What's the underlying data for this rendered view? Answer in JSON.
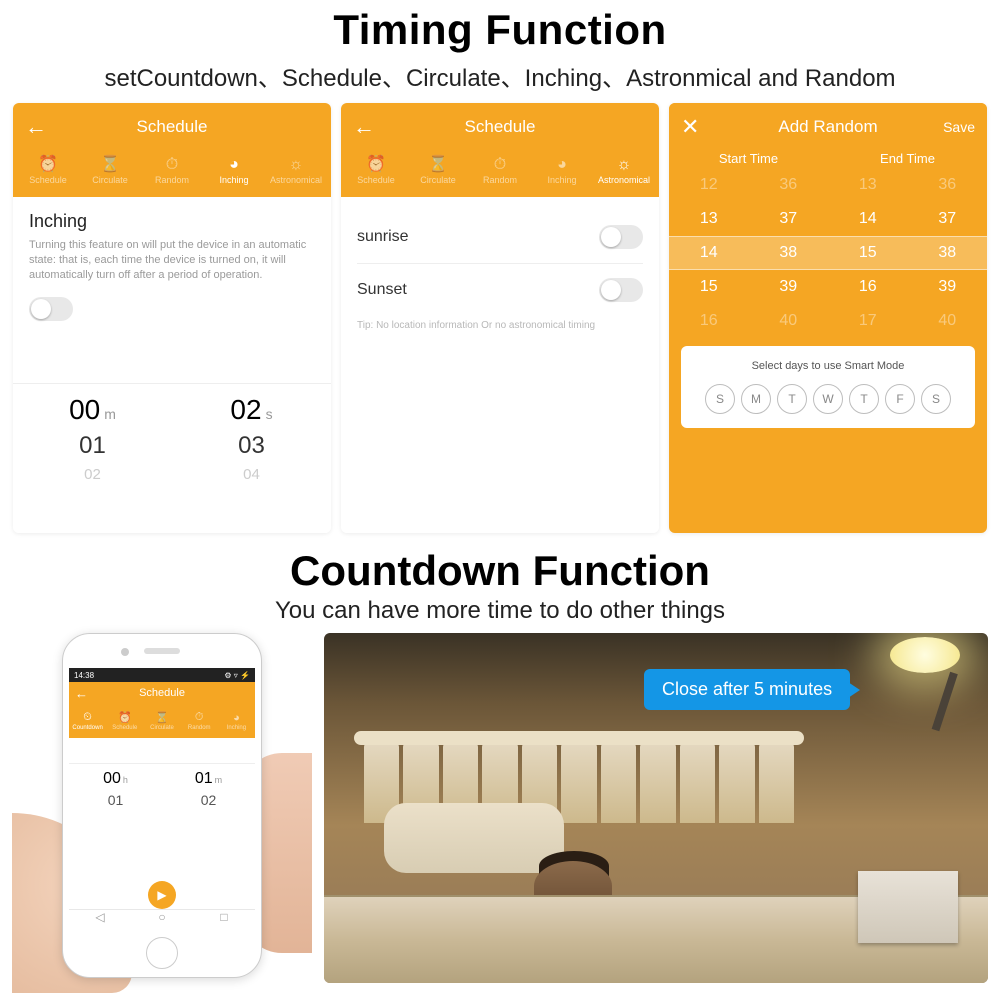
{
  "colors": {
    "primary": "#f5a623",
    "bubble": "#1496e6"
  },
  "section1": {
    "title": "Timing Function",
    "subtitle": "setCountdown、Schedule、Circulate、Inching、Astronmical and Random"
  },
  "tabs": [
    {
      "label": "Schedule",
      "icon": "⏰"
    },
    {
      "label": "Circulate",
      "icon": "⌛"
    },
    {
      "label": "Random",
      "icon": "⏱"
    },
    {
      "label": "Inching",
      "icon": "◕"
    },
    {
      "label": "Astronomical",
      "icon": "☼"
    }
  ],
  "screenA": {
    "headerTitle": "Schedule",
    "back": "←",
    "activeTab": "Inching",
    "body": {
      "title": "Inching",
      "desc": "Turning this feature on will put the device in an automatic state: that is, each time the device is turned on, it will automatically turn off after a period of operation."
    },
    "picker": {
      "m": {
        "top": "00",
        "unit": "m",
        "mid": "01",
        "bot": "02"
      },
      "s": {
        "top": "02",
        "unit": "s",
        "mid": "03",
        "bot": "04"
      }
    }
  },
  "screenB": {
    "headerTitle": "Schedule",
    "back": "←",
    "activeTab": "Astronomical",
    "rows": {
      "sunrise": "sunrise",
      "sunset": "Sunset"
    },
    "tip": "Tip: No location information Or no astronomical timing"
  },
  "screenC": {
    "headerTitle": "Add Random",
    "close": "✕",
    "save": "Save",
    "startLabel": "Start Time",
    "endLabel": "End Time",
    "rows": [
      {
        "a": "12",
        "b": "36",
        "c": "13",
        "d": "36",
        "cls": "dim"
      },
      {
        "a": "13",
        "b": "37",
        "c": "14",
        "d": "37",
        "cls": ""
      },
      {
        "a": "14",
        "b": "38",
        "c": "15",
        "d": "38",
        "cls": "sel"
      },
      {
        "a": "15",
        "b": "39",
        "c": "16",
        "d": "39",
        "cls": ""
      },
      {
        "a": "16",
        "b": "40",
        "c": "17",
        "d": "40",
        "cls": "dim"
      }
    ],
    "daysTitle": "Select days to use Smart Mode",
    "days": [
      "S",
      "M",
      "T",
      "W",
      "T",
      "F",
      "S"
    ]
  },
  "section2": {
    "title": "Countdown Function",
    "subtitle": "You can have more time to do other things"
  },
  "phone": {
    "time": "14:38",
    "hdr": "Schedule",
    "back": "←",
    "activeTab": "Countdown",
    "tabs": [
      {
        "label": "Countdown",
        "icon": "⏲"
      },
      {
        "label": "Schedule",
        "icon": "⏰"
      },
      {
        "label": "Circulate",
        "icon": "⌛"
      },
      {
        "label": "Random",
        "icon": "⏱"
      },
      {
        "label": "Inching",
        "icon": "◕"
      }
    ],
    "picker": {
      "h": {
        "top": "00",
        "unit": "h",
        "mid": "01",
        "bot": ""
      },
      "m": {
        "top": "01",
        "unit": "m",
        "mid": "02",
        "bot": ""
      }
    },
    "go": "▶",
    "nav": [
      "◁",
      "○",
      "□"
    ]
  },
  "bubble": "Close after 5 minutes"
}
